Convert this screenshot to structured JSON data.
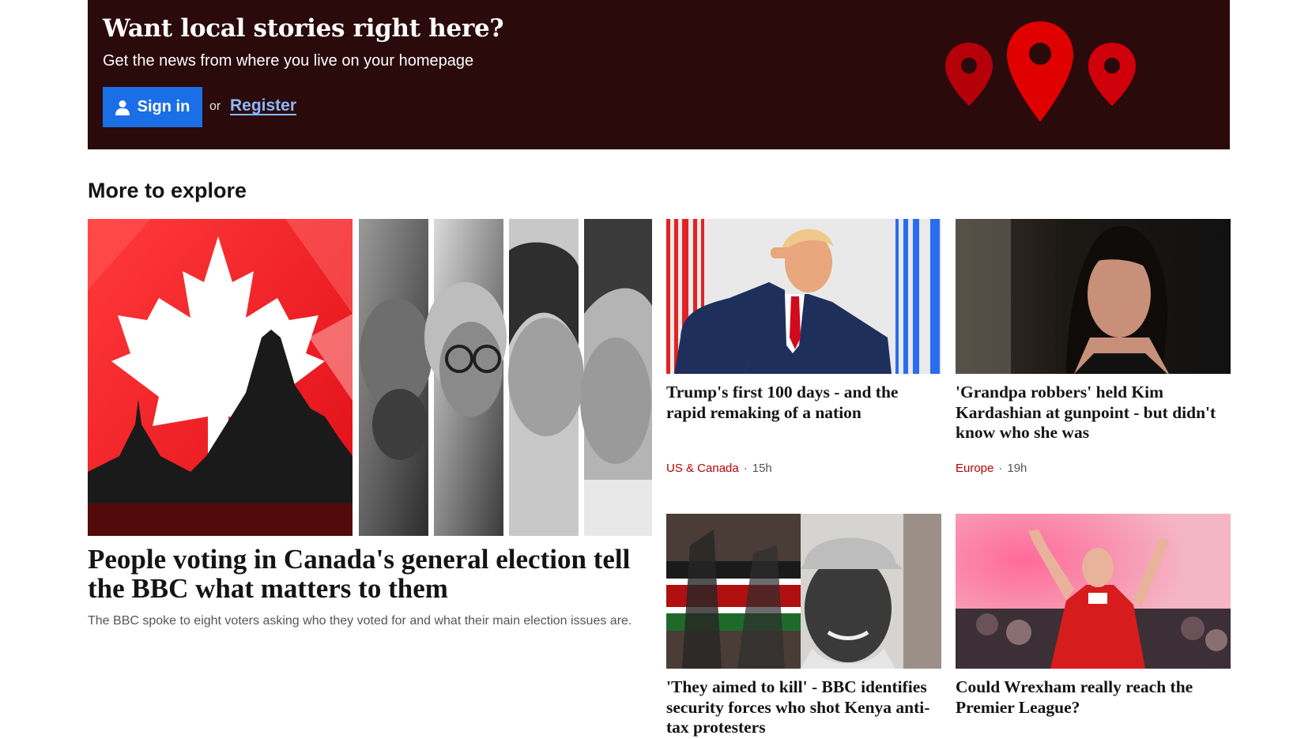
{
  "promo": {
    "title": "Want local stories right here?",
    "subtitle": "Get the news from where you live on your homepage",
    "signin_label": "Sign in",
    "or_text": "or",
    "register_label": "Register",
    "background_color": "#2a0a0b",
    "pin_color": "#e00000",
    "pin_dark_color": "#b5000a"
  },
  "section": {
    "title": "More to explore"
  },
  "hero": {
    "headline": "People voting in Canada's general election tell the BBC what matters to them",
    "summary": "The BBC spoke to eight voters asking who they voted for and what their main election issues are.",
    "image_icon": "canada-flag-parliament-voters-image"
  },
  "cards": [
    {
      "headline": "Trump's first 100 days - and the rapid remaking of a nation",
      "category": "US & Canada",
      "time": "15h",
      "image_icon": "trump-salute-image"
    },
    {
      "headline": "'Grandpa robbers' held Kim Kardashian at gunpoint - but didn't know who she was",
      "category": "Europe",
      "time": "19h",
      "image_icon": "kim-kardashian-image"
    },
    {
      "headline": "'They aimed to kill' - BBC identifies security forces who shot Kenya anti-tax protesters",
      "image_icon": "kenya-protest-image"
    },
    {
      "headline": "Could Wrexham really reach the Premier League?",
      "image_icon": "wrexham-fans-image"
    }
  ],
  "meta_separator": "·"
}
